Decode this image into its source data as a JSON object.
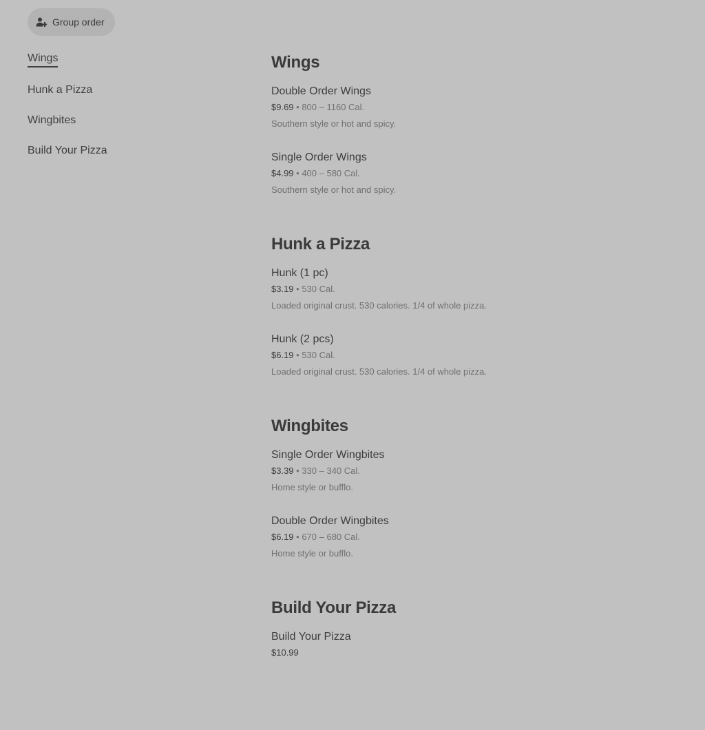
{
  "group_order": {
    "label": "Group order",
    "icon": "add-person-icon"
  },
  "nav": {
    "items": [
      {
        "label": "Wings",
        "active": true
      },
      {
        "label": "Hunk a Pizza",
        "active": false
      },
      {
        "label": "Wingbites",
        "active": false
      },
      {
        "label": "Build Your Pizza",
        "active": false
      }
    ]
  },
  "menu": {
    "sections": [
      {
        "title": "Wings",
        "items": [
          {
            "name": "Double Order Wings",
            "price": "$9.69",
            "sep": " • ",
            "cal": "800 – 1160 Cal.",
            "desc": "Southern style or hot and spicy."
          },
          {
            "name": "Single Order Wings",
            "price": "$4.99",
            "sep": " • ",
            "cal": "400 – 580 Cal.",
            "desc": "Southern style or hot and spicy."
          }
        ]
      },
      {
        "title": "Hunk a Pizza",
        "items": [
          {
            "name": "Hunk (1 pc)",
            "price": "$3.19",
            "sep": " • ",
            "cal": "530 Cal.",
            "desc": "Loaded original crust. 530 calories. 1/4 of whole pizza."
          },
          {
            "name": "Hunk (2 pcs)",
            "price": "$6.19",
            "sep": " • ",
            "cal": "530 Cal.",
            "desc": "Loaded original crust. 530 calories. 1/4 of whole pizza."
          }
        ]
      },
      {
        "title": "Wingbites",
        "items": [
          {
            "name": "Single Order Wingbites",
            "price": "$3.39",
            "sep": " • ",
            "cal": "330 – 340 Cal.",
            "desc": "Home style or bufflo."
          },
          {
            "name": "Double Order Wingbites",
            "price": "$6.19",
            "sep": " • ",
            "cal": "670 – 680 Cal.",
            "desc": "Home style or bufflo."
          }
        ]
      },
      {
        "title": "Build Your Pizza",
        "items": [
          {
            "name": "Build Your Pizza",
            "price": "$10.99"
          }
        ]
      }
    ]
  }
}
